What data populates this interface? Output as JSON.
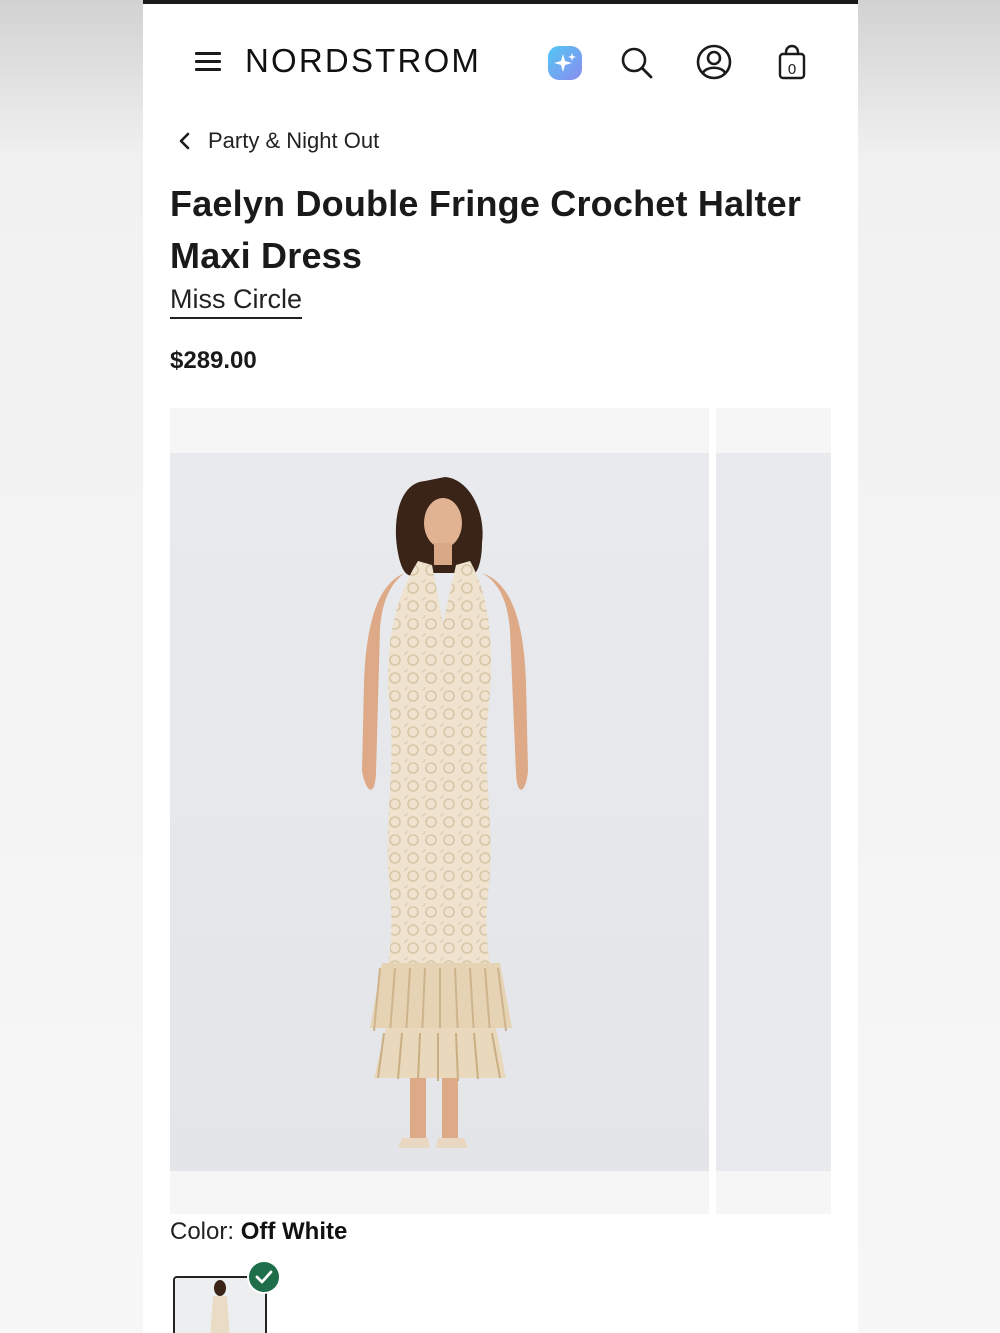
{
  "header": {
    "logo": "NORDSTROM",
    "icons": [
      "menu-icon",
      "ai-sparkle-icon",
      "search-icon",
      "account-icon",
      "shopping-bag-icon"
    ],
    "bag_count": "0"
  },
  "breadcrumb": {
    "label": "Party & Night Out"
  },
  "product": {
    "title": "Faelyn Double Fringe Crochet Halter Maxi Dress",
    "brand": "Miss Circle",
    "price": "$289.00",
    "color_label": "Color: ",
    "color_value": "Off White"
  },
  "colors": {
    "accent": "#1f6e4a",
    "text": "#1a1a1a",
    "photo_bg": "#e7e9ec"
  }
}
